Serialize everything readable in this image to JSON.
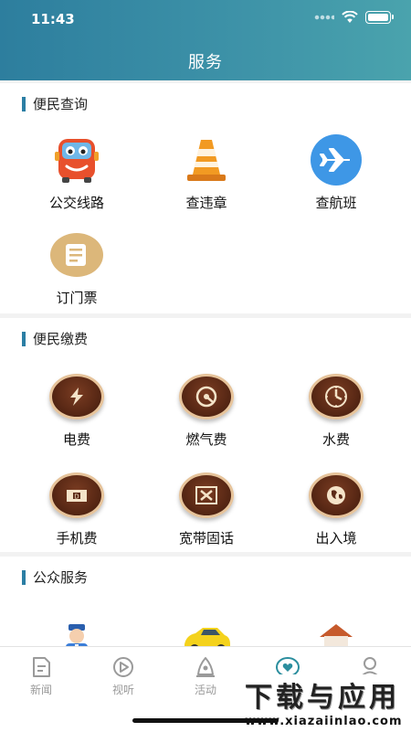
{
  "status_bar": {
    "time": "11:43"
  },
  "header": {
    "title": "服务"
  },
  "sections": [
    {
      "title": "便民查询",
      "items": [
        {
          "label": "公交线路",
          "icon": "bus-icon"
        },
        {
          "label": "查违章",
          "icon": "traffic-cone-icon"
        },
        {
          "label": "查航班",
          "icon": "airplane-icon"
        },
        {
          "label": "订门票",
          "icon": "ticket-icon"
        }
      ]
    },
    {
      "title": "便民缴费",
      "items": [
        {
          "label": "电费",
          "icon": "lightning-icon"
        },
        {
          "label": "燃气费",
          "icon": "gas-gauge-icon"
        },
        {
          "label": "水费",
          "icon": "water-meter-icon"
        },
        {
          "label": "手机费",
          "icon": "phone-recharge-icon"
        },
        {
          "label": "宽带固话",
          "icon": "broadband-icon"
        },
        {
          "label": "出入境",
          "icon": "globe-icon"
        }
      ]
    },
    {
      "title": "公众服务",
      "items": [
        {
          "label": "",
          "icon": "police-icon"
        },
        {
          "label": "",
          "icon": "taxi-icon"
        },
        {
          "label": "",
          "icon": "house-icon"
        }
      ]
    }
  ],
  "tabbar": [
    {
      "label": "新闻",
      "icon": "news-icon"
    },
    {
      "label": "视听",
      "icon": "play-icon"
    },
    {
      "label": "活动",
      "icon": "activity-icon"
    },
    {
      "label": "",
      "icon": "service-heart-icon"
    },
    {
      "label": "",
      "icon": "user-icon"
    }
  ],
  "watermark": {
    "line1": "下载与应用",
    "line2": "www.xiazaiinlao.com"
  },
  "colors": {
    "header_start": "#2d7e9e",
    "header_end": "#4aa3ad",
    "accent_bar": "#2b7ea4"
  }
}
